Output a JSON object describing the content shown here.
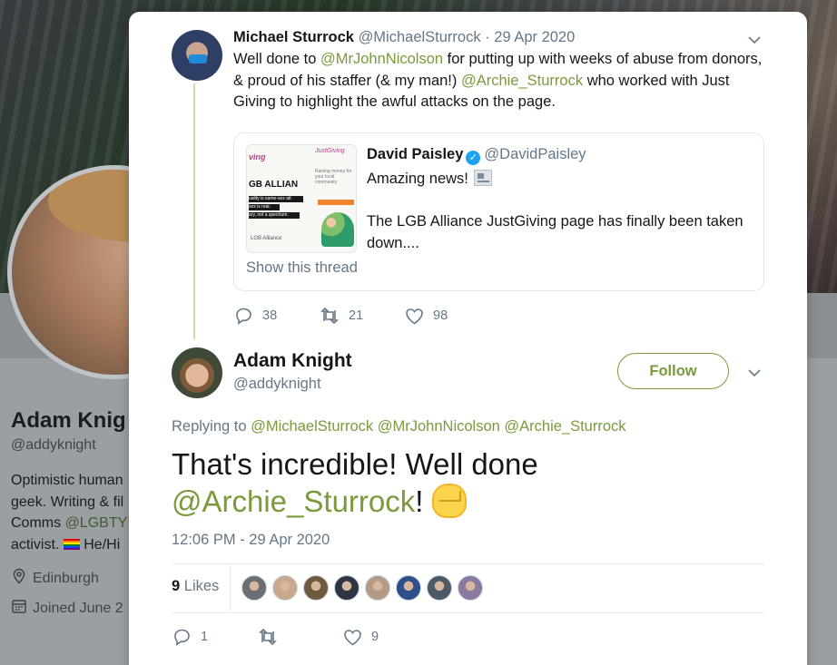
{
  "background_profile": {
    "name": "Adam Knig",
    "handle": "@addyknight",
    "bio_lines": [
      "Optimistic human",
      "geek. Writing & fil",
      "Comms ",
      "activist. "
    ],
    "bio_link": "@LGBTY",
    "bio_pronouns": " He/Hi",
    "location": "Edinburgh",
    "joined": "Joined June 2"
  },
  "original_tweet": {
    "author_name": "Michael Sturrock",
    "author_handle": "@MichaelSturrock",
    "separator": " · ",
    "date": "29 Apr 2020",
    "text_parts": {
      "p1": "Well done to ",
      "mention1": "@MrJohnNicolson",
      "p2": " for putting up with weeks of abuse from donors, & proud of his staffer (& my man!) ",
      "mention2": "@Archie_Sturrock",
      "p3": " who worked with Just Giving to highlight the awful attacks on the page."
    },
    "quoted": {
      "author_name": "David Paisley",
      "verified_icon": "✓",
      "author_handle": "@DavidPaisley",
      "line1": "Amazing news!",
      "line2": "The LGB Alliance JustGiving page has finally been taken down....",
      "show_thread": "Show this thread",
      "image": {
        "logo_left": "ving",
        "logo_right": "JustGiving",
        "raising": "Raising money for your local community",
        "brand": "GB ALLIAN",
        "bar1": "uality is same-sex att",
        "bar2": "sex is real.",
        "bar3": "ary, not a spectrum.",
        "footer": "LGB Alliance"
      }
    },
    "actions": {
      "replies": "38",
      "retweets": "21",
      "likes": "98"
    }
  },
  "reply_tweet": {
    "author_name": "Adam Knight",
    "author_handle": "@addyknight",
    "follow_label": "Follow",
    "replying_label": "Replying to ",
    "replying_to": "@MichaelSturrock @MrJohnNicolson @Archie_Sturrock",
    "text_p1": "That's incredible! Well done ",
    "text_mention": "@Archie_Sturrock",
    "text_p2": "!",
    "timestamp": "12:06 PM - 29 Apr 2020",
    "likes_count": "9",
    "likes_label": " Likes",
    "liker_colors": [
      "#6b6f73",
      "#c9a98e",
      "#6e5a3f",
      "#2d3542",
      "#b59a86",
      "#2f4f8a",
      "#4b5a65",
      "#8a7aa0"
    ],
    "actions": {
      "replies": "1",
      "retweets": "",
      "likes": "9"
    }
  },
  "colors": {
    "accent": "#7a9a3c",
    "muted": "#657786",
    "text": "#14171a"
  }
}
